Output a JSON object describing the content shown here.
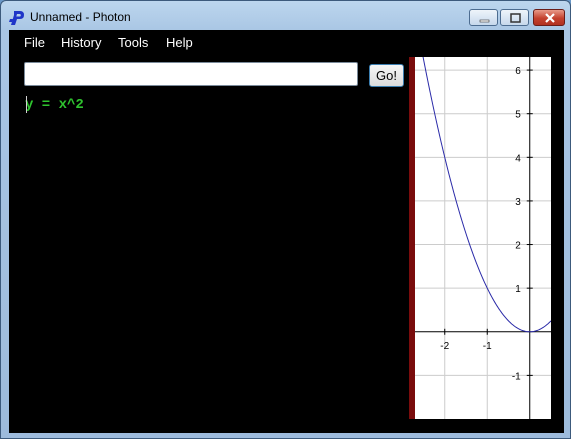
{
  "window": {
    "title": "Unnamed - Photon",
    "icon": "photon-p-icon",
    "controls": [
      "minimize-icon",
      "maximize-icon",
      "close-icon"
    ]
  },
  "menu": {
    "items": [
      "File",
      "History",
      "Tools",
      "Help"
    ]
  },
  "command": {
    "input_value": "",
    "placeholder": "",
    "go_label": "Go!"
  },
  "console": {
    "expression": "y = x^2",
    "text_color": "#2fc42f"
  },
  "chart_data": {
    "type": "line",
    "series": [
      {
        "function": "y = x^2",
        "x": [
          -2.6,
          -2.5,
          -2.25,
          -2.0,
          -1.75,
          -1.5,
          -1.25,
          -1.0,
          -0.75,
          -0.5,
          -0.25,
          0.0,
          0.25,
          0.5
        ],
        "y": [
          6.76,
          6.25,
          5.0625,
          4.0,
          3.0625,
          2.25,
          1.5625,
          1.0,
          0.5625,
          0.25,
          0.0625,
          0.0,
          0.0625,
          0.25
        ],
        "color": "#2a2aa8"
      }
    ],
    "x_ticks": [
      "-2",
      "-1"
    ],
    "y_ticks": [
      "6",
      "5",
      "4",
      "3",
      "2",
      "1",
      "-1"
    ],
    "xlim": [
      -2.7,
      0.5
    ],
    "ylim": [
      -2.0,
      6.3
    ],
    "grid": true,
    "background": "#ffffff",
    "grid_color": "#cccccc",
    "axis_color": "#000000"
  }
}
